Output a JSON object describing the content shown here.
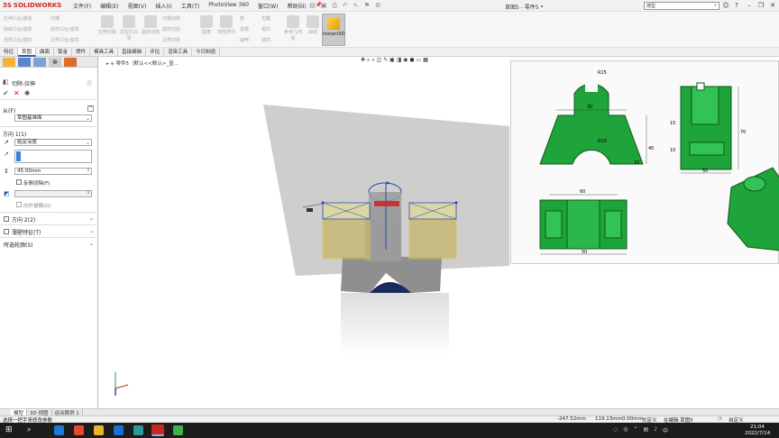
{
  "app": {
    "logo_text": "SOLIDWORKS",
    "logo_prefix": "3S",
    "doc_title": "草图5 - 零件5 *",
    "search_placeholder": "搜型",
    "menu": [
      "文件(F)",
      "编辑(E)",
      "视图(V)",
      "插入(I)",
      "工具(T)",
      "PhotoView 360",
      "窗口(W)",
      "帮助(H)"
    ]
  },
  "commands": {
    "small_col1": [
      "拉伸凸台/基体",
      "旋转凸台/基体",
      "放样凸台/基体"
    ],
    "scan": "扫描",
    "small_col2": [
      "扫描",
      "放样凸台/基体",
      "边界凸台/基体"
    ],
    "big": [
      {
        "label": "拉伸切除"
      },
      {
        "label": "异型孔向导"
      },
      {
        "label": "旋转切除"
      }
    ],
    "small_col3": [
      "扫描切除",
      "放样切割",
      "边界切除"
    ],
    "big2": [
      {
        "label": "圆角"
      },
      {
        "label": "线性阵列"
      }
    ],
    "small_col4": [
      "筋",
      "拔模",
      "抽壳"
    ],
    "small_col5": [
      "包覆",
      "相交",
      "镜向"
    ],
    "big3": [
      {
        "label": "参考几何体"
      },
      {
        "label": "曲线"
      }
    ],
    "instant3d": "Instant3D"
  },
  "tabs": [
    "特征",
    "草图",
    "曲面",
    "钣金",
    "焊件",
    "模具工具",
    "直接编辑",
    "评估",
    "渲染工具",
    "今日制造"
  ],
  "active_tab": "草图",
  "panel": {
    "feature_title": "切除-拉伸",
    "from_label": "从(F)",
    "from_value": "草图基准面",
    "dir1_label": "方向 1(1)",
    "dir1_value": "给定深度",
    "depth_value": "45.00mm",
    "reverse_label": "反侧切除(F)",
    "draft_label": "向外拔模(O)",
    "dir2_label": "方向 2(2)",
    "thin_label": "薄壁特征(T)",
    "contours_label": "所选轮廓(S)"
  },
  "viewport": {
    "crumb": "零件5（默认<<默认>_显..."
  },
  "drawing": {
    "dims_top": [
      "R15",
      "30",
      "R10",
      "40",
      "10"
    ],
    "dims_side": [
      "15",
      "70",
      "10",
      "50"
    ],
    "dims_plan": [
      "60",
      "50"
    ]
  },
  "bottom_tabs": [
    "模型",
    "3D 视图",
    "运动算例 1"
  ],
  "bottom_active": "模型",
  "status": {
    "left": "选择一把手来修改参数",
    "coord_x": "-247.52mm",
    "coord_y": "119.13mm",
    "coord_z": "0.00mm",
    "defined": "欠定义",
    "editing": "在编辑 草图5",
    "units": "自定义"
  },
  "taskbar": {
    "time": "21:04",
    "date": "2022/7/14"
  },
  "colors": {
    "accent": "#2b5cb5",
    "green": "#1ea43a",
    "model_grey": "#8c8c8c",
    "sketch_yellow": "#d9c86a"
  }
}
